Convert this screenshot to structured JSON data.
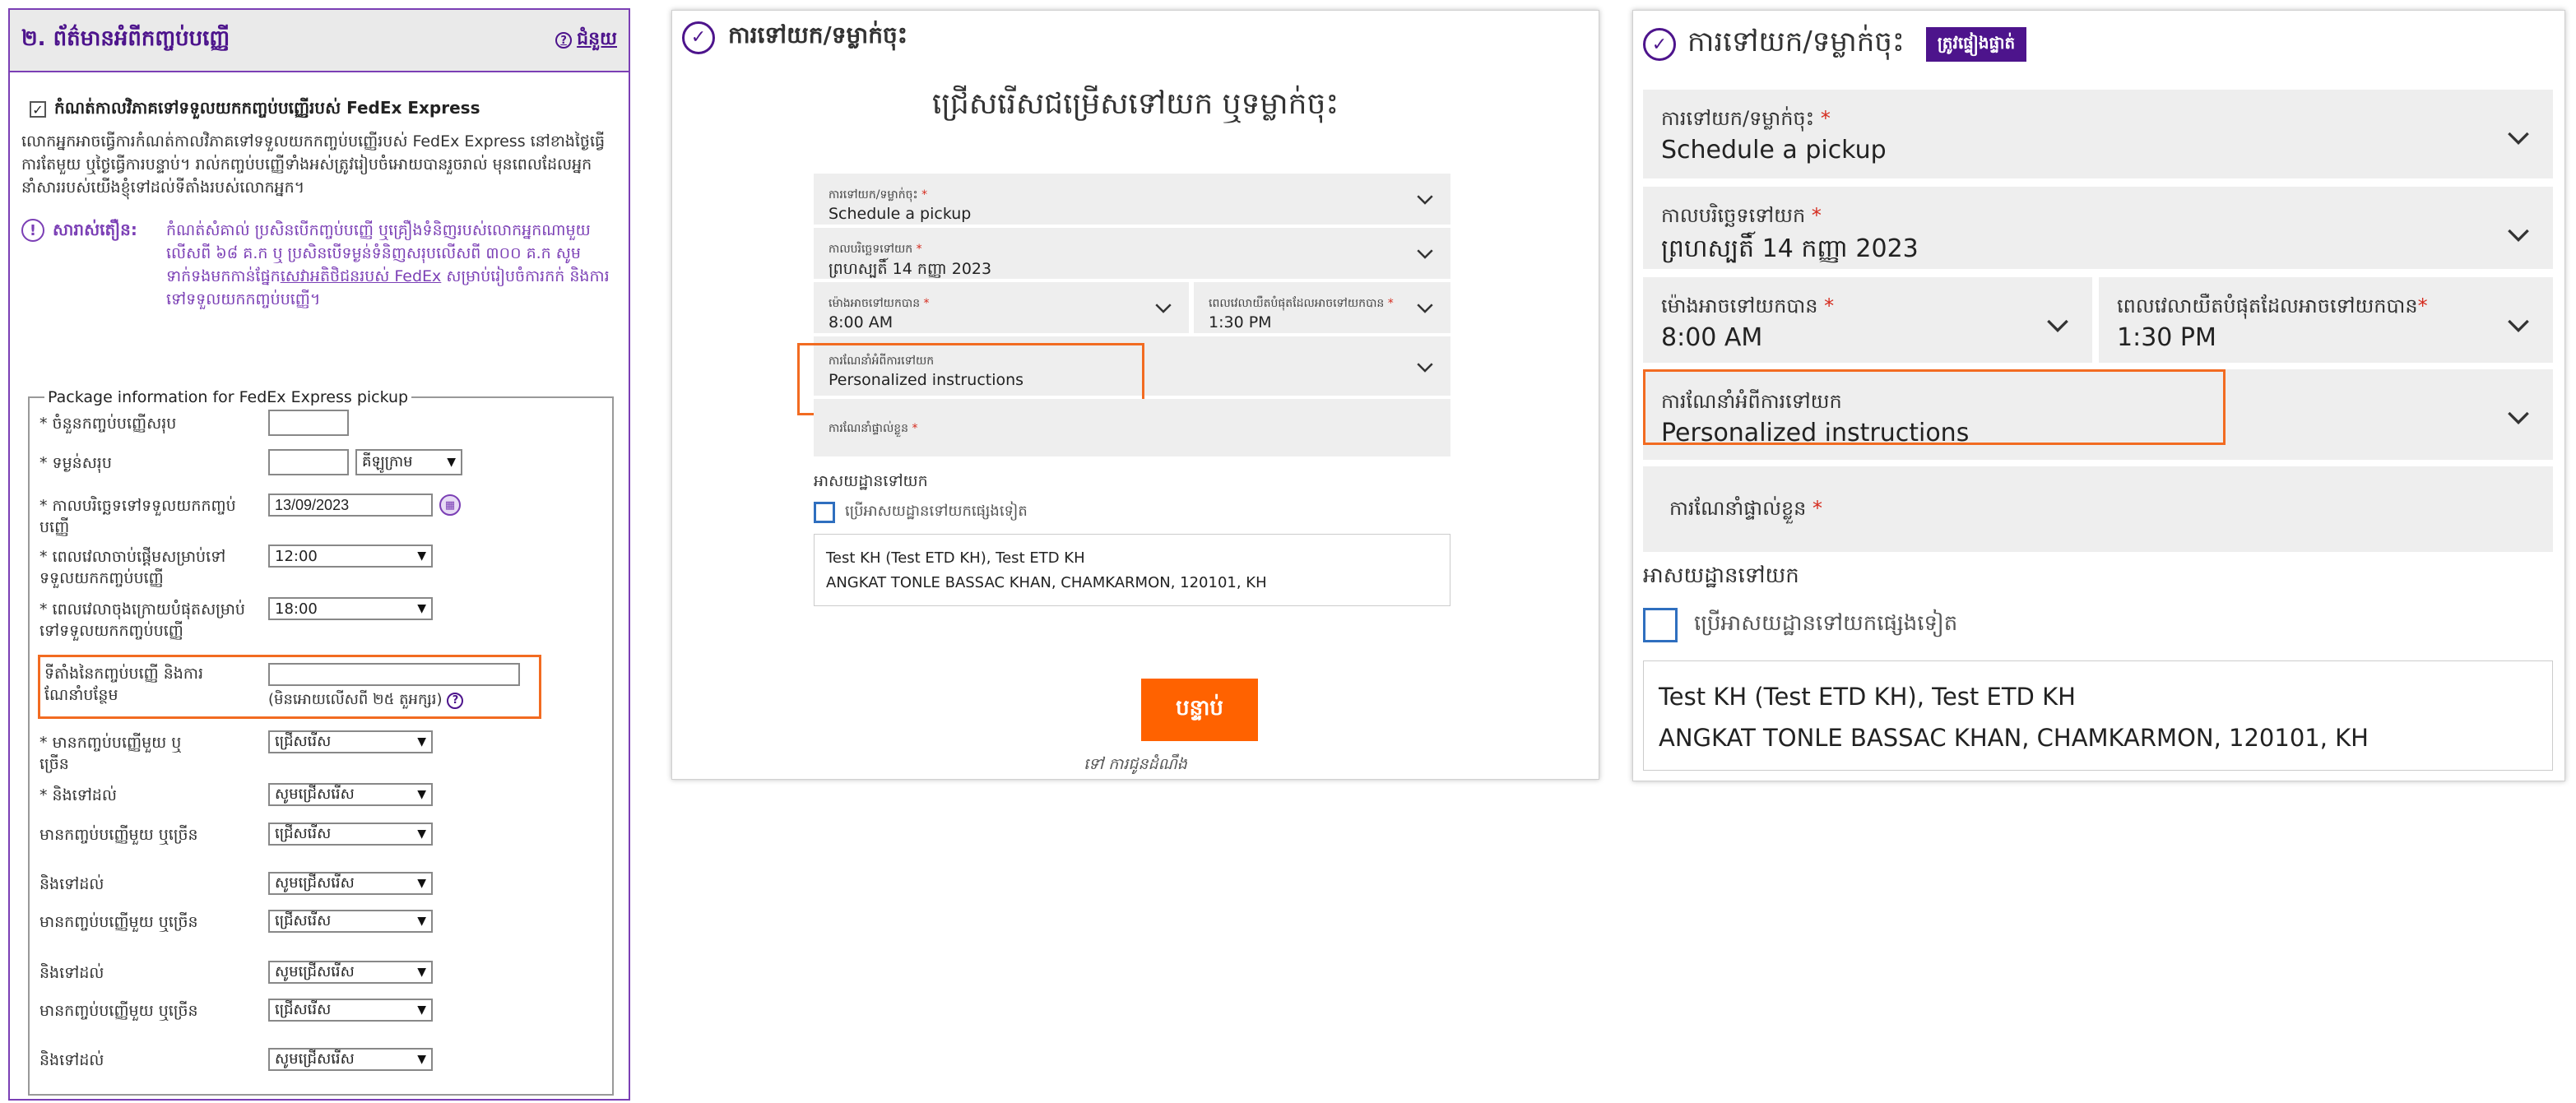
{
  "legacy": {
    "section_title": "២. ព័ត៌មានអំពីកញ្ចប់បញ្ញើ",
    "help_label": "ជំនួយ",
    "schedule_checkbox_label": "កំណត់កាលវិភាគទៅទទួលយកកញ្ចប់បញ្ញើរបស់ FedEx Express",
    "schedule_checked": "✓",
    "description": "លោកអ្នកអាចធ្វើការកំណត់កាលវិភាគទៅទទួលយកកញ្ចប់បញ្ញើរបស់ FedEx Express នៅខាងថ្ងៃធ្វើការតែមួយ ឬថ្ងៃធ្វើការបន្ទាប់។ រាល់កញ្ចប់បញ្ញើទាំងអស់ត្រូវរៀបចំអោយបានរួចរាល់ មុនពេលដែលអ្នកនាំសាររបស់យើងខ្ញុំទៅដល់ទីតាំងរបស់លោកអ្នក។",
    "warning_label": "សារាស់តឿន:",
    "warning_text": "កំណត់សំគាល់ ប្រសិនបើកញ្ចប់បញ្ញើ ឬគ្រឿងទំនិញរបស់លោកអ្នកណាមួយ លើសពី ៦៨ គ.ក ឬ ប្រសិនបើទម្ងន់ទំនិញសរុបលើសពី ៣០០ គ.ក សូមទាក់ទងមកកាន់ផ្នែក",
    "warning_link": "សេវាអតិថិជនរបស់ FedEx",
    "warning_tail": " សម្រាប់រៀបចំការកក់ និងការទៅទទួលយកកញ្ចប់បញ្ញើ។",
    "fieldset_legend": "Package information for FedEx Express pickup",
    "fields": {
      "total_packages_label": "* ចំនួនកញ្ចប់បញ្ញើសរុប",
      "total_weight_label": "* ទម្ងន់សរុប",
      "weight_unit": "គីឡូក្រាម",
      "pickup_date_label": "* កាលបរិច្ឆេទទៅទទួលយកកញ្ចប់បញ្ញើ",
      "pickup_date_value": "13/09/2023",
      "ready_time_label": "* ពេលវេលាចាប់ផ្តើមសម្រាប់ទៅទទួលយកកញ្ចប់បញ្ញើ",
      "ready_time_value": "12:00",
      "close_time_label": "* ពេលវេលាចុងក្រោយបំផុតសម្រាប់ទៅទទួលយកកញ្ចប់បញ្ញើ",
      "close_time_value": "18:00",
      "location_label": "ទីតាំងនៃកញ្ចប់បញ្ញើ និងការណែនាំបន្ថែម",
      "location_hint": "(មិនអោយលើសពី ២៥ តួអក្សរ)",
      "pkg1_label": "* មានកញ្ចប់បញ្ញើមួយ ឬច្រើន",
      "pkg1_value": "ជ្រើសរើស",
      "dest1_label": "* និងទៅដល់",
      "dest1_value": "សូមជ្រើសរើស",
      "pkg2_label": "មានកញ្ចប់បញ្ញើមួយ ឬច្រើន",
      "pkg2_value": "ជ្រើសរើស",
      "dest2_label": "និងទៅដល់",
      "dest2_value": "សូមជ្រើសរើស",
      "pkg3_label": "មានកញ្ចប់បញ្ញើមួយ ឬច្រើន",
      "pkg3_value": "ជ្រើសរើស",
      "dest3_label": "និងទៅដល់",
      "dest3_value": "សូមជ្រើសរើស",
      "pkg4_label": "មានកញ្ចប់បញ្ញើមួយ ឬច្រើន",
      "pkg4_value": "ជ្រើសរើស",
      "dest4_label": "និងទៅដល់",
      "dest4_value": "សូមជ្រើសរើស"
    }
  },
  "middle": {
    "title": "ការទៅយក/ទម្លាក់ចុះ",
    "subtitle": "ជ្រើសរើសជម្រើសទៅយក ឬទម្លាក់ចុះ",
    "pickup_dropoff_label": "ការទៅយក/ទម្លាក់ចុះ",
    "pickup_dropoff_value": "Schedule a pickup",
    "pickup_date_label": "កាលបរិច្ឆេទទៅយក",
    "pickup_date_value": "ព្រហស្បតិ៍ 14 កញ្ញា 2023",
    "ready_time_label": "ម៉ោងអាចទៅយកបាន",
    "ready_time_value": "8:00 AM",
    "latest_time_label": "ពេលវេលាយឺតបំផុតដែលអាចទៅយកបាន",
    "latest_time_value": "1:30 PM",
    "instructions_label": "ការណែនាំអំពីការទៅយក",
    "instructions_value": "Personalized instructions",
    "personal_instructions_label": "ការណែនាំផ្ទាល់ខ្លួន",
    "required_mark": "*",
    "address_heading": "អាសយដ្ឋានទៅយក",
    "alt_address_label": "ប្រើអាសយដ្ឋានទៅយកផ្សេងទៀត",
    "address_line1": "Test KH (Test ETD KH), Test ETD KH",
    "address_line2": "ANGKAT TONLE BASSAC KHAN, CHAMKARMON, 120101, KH",
    "next_button": "បន្ទាប់",
    "back_link": "ទៅ ការជូនដំណឹង"
  },
  "right": {
    "title": "ការទៅយក/ទម្លាក់ចុះ",
    "badge": "ត្រូវផ្ទៀងផ្ទាត់",
    "pickup_dropoff_label": "ការទៅយក/ទម្លាក់ចុះ",
    "pickup_dropoff_value": "Schedule a pickup",
    "pickup_date_label": "កាលបរិច្ឆេទទៅយក",
    "pickup_date_value": "ព្រហស្បតិ៍ 14 កញ្ញា 2023",
    "ready_time_label": "ម៉ោងអាចទៅយកបាន",
    "ready_time_value": "8:00 AM",
    "latest_time_label": "ពេលវេលាយឺតបំផុតដែលអាចទៅយកបាន",
    "latest_time_value": "1:30 PM",
    "instructions_label": "ការណែនាំអំពីការទៅយក",
    "instructions_value": "Personalized instructions",
    "personal_instructions_label": "ការណែនាំផ្ទាល់ខ្លួន",
    "required_mark": "*",
    "address_heading": "អាសយដ្ឋានទៅយក",
    "alt_address_label": "ប្រើអាសយដ្ឋានទៅយកផ្សេងទៀត",
    "address_line1": "Test KH (Test ETD KH), Test ETD KH",
    "address_line2": "ANGKAT TONLE BASSAC KHAN, CHAMKARMON, 120101, KH"
  },
  "colors": {
    "fedex_purple": "#4d148c",
    "highlight_orange": "#f26b21",
    "button_orange": "#ff6200",
    "field_bg": "#eeeeee",
    "required_red": "#d52b1e"
  },
  "icons": {
    "check": "check-circle-icon",
    "chevron": "chevron-down-icon",
    "help": "question-circle-icon",
    "warning": "exclamation-circle-icon",
    "calendar": "calendar-icon"
  }
}
